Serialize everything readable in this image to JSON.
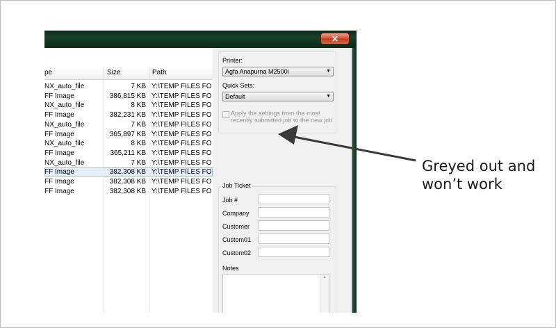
{
  "window": {
    "close_glyph": "✕"
  },
  "file_list": {
    "headers": {
      "type": "pe",
      "size": "Size",
      "path": "Path"
    },
    "rows": [
      {
        "type": "NX_auto_file",
        "size": "7 KB",
        "path": "Y:\\TEMP FILES FOR C"
      },
      {
        "type": "FF Image",
        "size": "386,815 KB",
        "path": "Y:\\TEMP FILES FOR C"
      },
      {
        "type": "NX_auto_file",
        "size": "8 KB",
        "path": "Y:\\TEMP FILES FOR C"
      },
      {
        "type": "FF Image",
        "size": "382,231 KB",
        "path": "Y:\\TEMP FILES FOR C"
      },
      {
        "type": "NX_auto_file",
        "size": "7 KB",
        "path": "Y:\\TEMP FILES FOR C"
      },
      {
        "type": "FF Image",
        "size": "365,897 KB",
        "path": "Y:\\TEMP FILES FOR C"
      },
      {
        "type": "NX_auto_file",
        "size": "8 KB",
        "path": "Y:\\TEMP FILES FOR C"
      },
      {
        "type": "FF Image",
        "size": "365,211 KB",
        "path": "Y:\\TEMP FILES FOR C"
      },
      {
        "type": "NX_auto_file",
        "size": "7 KB",
        "path": "Y:\\TEMP FILES FOR C"
      },
      {
        "type": "FF Image",
        "size": "382,308 KB",
        "path": "Y:\\TEMP FILES FOR C",
        "selected": true
      },
      {
        "type": "FF Image",
        "size": "382,308 KB",
        "path": "Y:\\TEMP FILES FOR C"
      },
      {
        "type": "FF Image",
        "size": "382,308 KB",
        "path": "Y:\\TEMP FILES FOR C"
      }
    ]
  },
  "printer_group": {
    "printer_label": "Printer:",
    "printer_value": "Agfa Anapurna M2500i",
    "quicksets_label": "Quick Sets:",
    "quicksets_value": "Default",
    "apply_settings_text": "Apply the settings from the most recently submitted job to the new job",
    "apply_settings_checked": false,
    "apply_settings_enabled": false
  },
  "job_ticket": {
    "title": "Job Ticket",
    "fields": [
      {
        "label": "Job #",
        "value": ""
      },
      {
        "label": "Company",
        "value": ""
      },
      {
        "label": "Customer",
        "value": ""
      },
      {
        "label": "Custom01",
        "value": ""
      },
      {
        "label": "Custom02",
        "value": ""
      }
    ],
    "notes_label": "Notes",
    "notes_value": ""
  },
  "annotation": {
    "text": "Greyed out and won’t work"
  },
  "colors": {
    "titlebar": "#123421",
    "close_button": "#c94a2c",
    "selected_row": "#e6eff9",
    "annotation_arrow": "#3a3a3a"
  }
}
